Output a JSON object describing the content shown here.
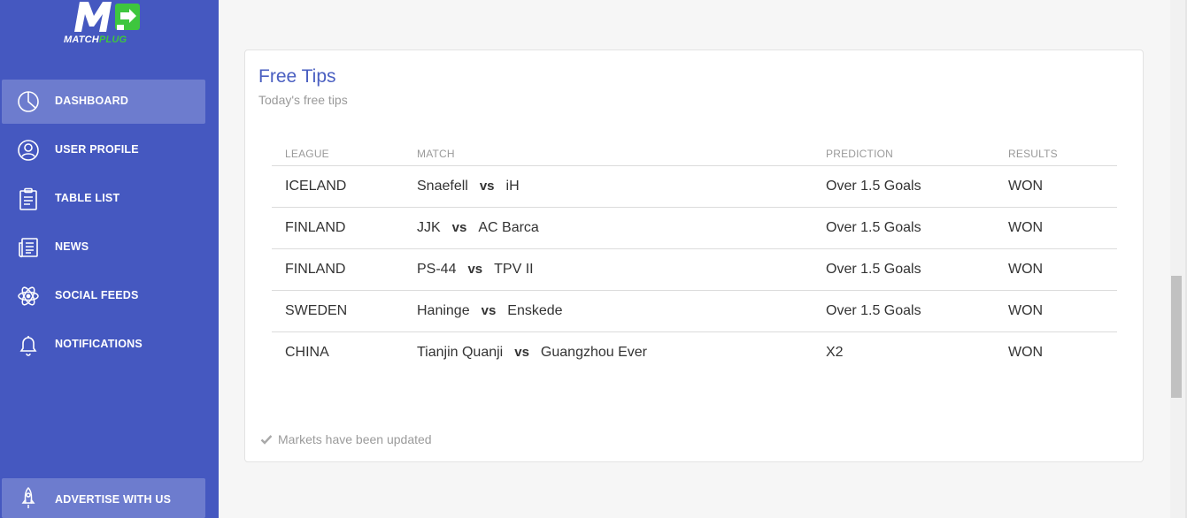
{
  "brand": {
    "logo_text_1": "MATCH",
    "logo_text_2": "PLUG",
    "accent_color": "#3ec63e",
    "sidebar_color": "#4558c0"
  },
  "sidebar": {
    "items": [
      {
        "label": "DASHBOARD",
        "icon": "pie-chart-icon",
        "active": true
      },
      {
        "label": "USER PROFILE",
        "icon": "user-icon",
        "active": false
      },
      {
        "label": "TABLE LIST",
        "icon": "clipboard-icon",
        "active": false
      },
      {
        "label": "NEWS",
        "icon": "newspaper-icon",
        "active": false
      },
      {
        "label": "SOCIAL FEEDS",
        "icon": "atom-icon",
        "active": false
      },
      {
        "label": "NOTIFICATIONS",
        "icon": "bell-icon",
        "active": false
      }
    ],
    "advertise": {
      "label": "ADVERTISE WITH US",
      "icon": "rocket-icon"
    }
  },
  "card": {
    "title": "Free Tips",
    "subtitle": "Today's free tips",
    "columns": [
      "LEAGUE",
      "MATCH",
      "PREDICTION",
      "RESULTS"
    ],
    "rows": [
      {
        "league": "ICELAND",
        "home": "Snaefell",
        "vs": "vs",
        "away": "iH",
        "prediction": "Over 1.5 Goals",
        "result": "WON"
      },
      {
        "league": "FINLAND",
        "home": "JJK",
        "vs": "vs",
        "away": "AC Barca",
        "prediction": "Over 1.5 Goals",
        "result": "WON"
      },
      {
        "league": "FINLAND",
        "home": "PS-44",
        "vs": "vs",
        "away": "TPV II",
        "prediction": "Over 1.5 Goals",
        "result": "WON"
      },
      {
        "league": "SWEDEN",
        "home": "Haninge",
        "vs": "vs",
        "away": "Enskede",
        "prediction": "Over 1.5 Goals",
        "result": "WON"
      },
      {
        "league": "CHINA",
        "home": "Tianjin Quanji",
        "vs": "vs",
        "away": "Guangzhou Ever",
        "prediction": "X2",
        "result": "WON"
      }
    ],
    "footer": "Markets have been updated",
    "footer_icon": "check-icon"
  }
}
